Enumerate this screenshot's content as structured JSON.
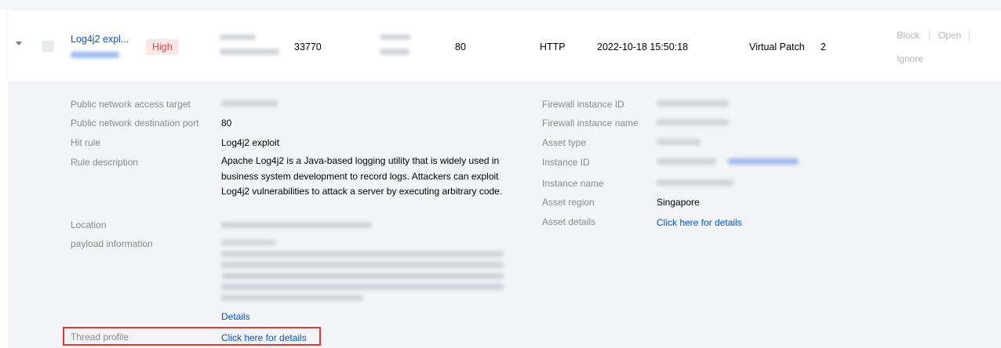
{
  "row": {
    "rule_name": "Log4j2 expl...",
    "risk_level": "High",
    "port_a": "33770",
    "port_b": "80",
    "protocol": "HTTP",
    "time": "2022-10-18 15:50:18",
    "disposal": "Virtual Patch",
    "count": "2",
    "actions": [
      "Block",
      "Open",
      "Ignore"
    ]
  },
  "details": {
    "left": [
      {
        "label": "Public network access target",
        "value": ""
      },
      {
        "label": "Public network destination port",
        "value": "80"
      },
      {
        "label": "Hit rule",
        "value": "Log4j2 exploit"
      },
      {
        "label": "Rule description",
        "value": "Apache Log4j2 is a Java-based logging utility that is widely used in business system development to record logs. Attackers can exploit Log4j2 vulnerabilities to attack a server by executing arbitrary code."
      },
      {
        "label": "Location",
        "value": ""
      },
      {
        "label": "payload information",
        "value": ""
      },
      {
        "label": "Thread profile",
        "value": "Click here for details"
      }
    ],
    "payload_link": "Details",
    "right": [
      {
        "label": "Firewall instance ID",
        "value": ""
      },
      {
        "label": "Firewall instance name",
        "value": ""
      },
      {
        "label": "Asset type",
        "value": ""
      },
      {
        "label": "Instance ID",
        "value": ""
      },
      {
        "label": "Instance name",
        "value": ""
      },
      {
        "label": "Asset region",
        "value": "Singapore"
      },
      {
        "label": "Asset details",
        "value": "Click here for details"
      }
    ]
  },
  "colors": {
    "link": "#0052d9",
    "high_badge_bg": "#fbe5e5",
    "high_badge_text": "#e54545",
    "highlight": "#e03b2d"
  }
}
